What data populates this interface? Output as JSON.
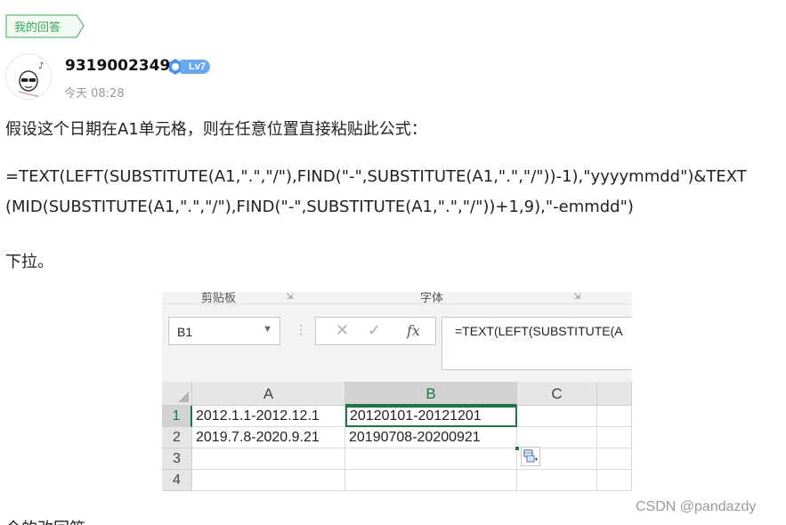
{
  "tag": {
    "label": "我的回答"
  },
  "user": {
    "name": "9319002349",
    "level": "Lv7",
    "time": "今天 08:28"
  },
  "answer": {
    "intro": "假设这个日期在A1单元格，则在任意位置直接粘贴此公式：",
    "formula_line1": "=TEXT(LEFT(SUBSTITUTE(A1,\".\",\"/\"),FIND(\"-\",SUBSTITUTE(A1,\".\",\"/\"))-1),\"yyyymmdd\")&TEXT",
    "formula_line2": "(MID(SUBSTITUTE(A1,\".\",\"/\"),FIND(\"-\",SUBSTITUTE(A1,\".\",\"/\"))+1,9),\"-emmdd\")",
    "outro": "下拉。",
    "cutoff": "今的改回答"
  },
  "excel": {
    "ribbon_groups": [
      "剪贴板",
      "字体"
    ],
    "name_box": "B1",
    "formula_bar": "=TEXT(LEFT(SUBSTITUTE(A",
    "columns": [
      "A",
      "B",
      "C"
    ],
    "rows": [
      "1",
      "2",
      "3",
      "4"
    ],
    "cells": {
      "A1": "2012.1.1-2012.12.1",
      "B1": "20120101-20121201",
      "A2": "2019.7.8-2020.9.21",
      "B2": "20190708-20200921"
    },
    "accent": "#217346"
  },
  "watermark": "CSDN @pandazdy"
}
